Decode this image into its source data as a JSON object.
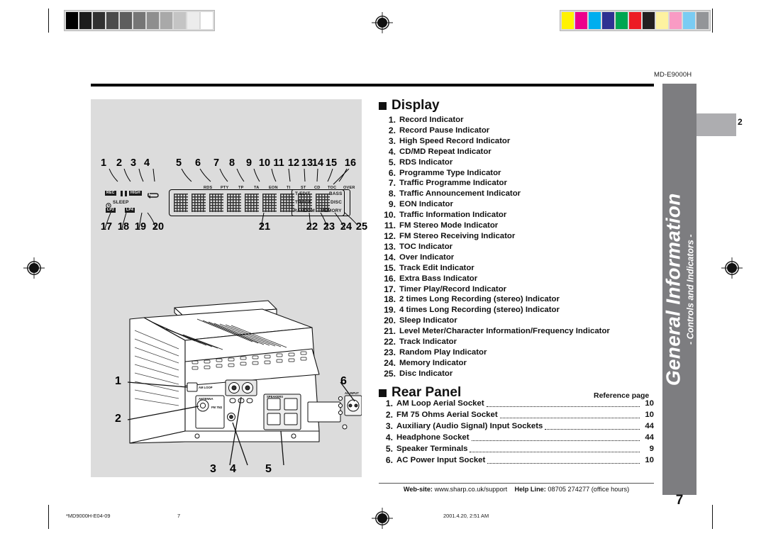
{
  "document": {
    "model_code": "MD-E9000H",
    "tab_number": "2",
    "page_number": "7",
    "sidebar_title": "General Information",
    "sidebar_subtitle": "- Controls and Indicators -"
  },
  "display_section": {
    "heading": "Display",
    "items": [
      {
        "n": "1.",
        "label": "Record Indicator"
      },
      {
        "n": "2.",
        "label": "Record Pause Indicator"
      },
      {
        "n": "3.",
        "label": "High Speed Record Indicator"
      },
      {
        "n": "4.",
        "label": "CD/MD Repeat Indicator"
      },
      {
        "n": "5.",
        "label": "RDS Indicator"
      },
      {
        "n": "6.",
        "label": "Programme Type Indicator"
      },
      {
        "n": "7.",
        "label": "Traffic Programme Indicator"
      },
      {
        "n": "8.",
        "label": "Traffic Announcement Indicator"
      },
      {
        "n": "9.",
        "label": "EON Indicator"
      },
      {
        "n": "10.",
        "label": "Traffic Information Indicator"
      },
      {
        "n": "11.",
        "label": "FM Stereo Mode Indicator"
      },
      {
        "n": "12.",
        "label": "FM Stereo Receiving Indicator"
      },
      {
        "n": "13.",
        "label": "TOC Indicator"
      },
      {
        "n": "14.",
        "label": "Over Indicator"
      },
      {
        "n": "15.",
        "label": "Track Edit Indicator"
      },
      {
        "n": "16.",
        "label": "Extra Bass Indicator"
      },
      {
        "n": "17.",
        "label": "Timer Play/Record Indicator"
      },
      {
        "n": "18.",
        "label": "2 times Long Recording (stereo) Indicator"
      },
      {
        "n": "19.",
        "label": "4 times Long Recording (stereo) Indicator"
      },
      {
        "n": "20.",
        "label": "Sleep Indicator"
      },
      {
        "n": "21.",
        "label": "Level Meter/Character Information/Frequency Indicator"
      },
      {
        "n": "22.",
        "label": "Track Indicator"
      },
      {
        "n": "23.",
        "label": "Random Play Indicator"
      },
      {
        "n": "24.",
        "label": "Memory Indicator"
      },
      {
        "n": "25.",
        "label": "Disc Indicator"
      }
    ]
  },
  "rear_panel_section": {
    "heading": "Rear Panel",
    "reference_page_label": "Reference page",
    "items": [
      {
        "n": "1.",
        "label": "AM Loop Aerial Socket",
        "page": "10"
      },
      {
        "n": "2.",
        "label": "FM 75 Ohms Aerial Socket",
        "page": "10"
      },
      {
        "n": "3.",
        "label": "Auxiliary (Audio Signal) Input Sockets",
        "page": "44"
      },
      {
        "n": "4.",
        "label": "Headphone Socket",
        "page": "44"
      },
      {
        "n": "5.",
        "label": "Speaker Terminals",
        "page": "9"
      },
      {
        "n": "6.",
        "label": "AC Power Input Socket",
        "page": "10"
      }
    ]
  },
  "lcd_diagram": {
    "top_callouts": [
      "1",
      "2",
      "3",
      "4",
      "5",
      "6",
      "7",
      "8",
      "9",
      "10",
      "11",
      "12",
      "13",
      "14",
      "15",
      "16"
    ],
    "bottom_callouts": [
      "17",
      "18",
      "19",
      "20",
      "21",
      "22",
      "23",
      "24",
      "25"
    ],
    "indicator_labels": [
      "REC",
      "HIGH",
      "SLEEP",
      "LP2",
      "LP4",
      "RDS",
      "PTY",
      "TP",
      "TA",
      "EON",
      "TI",
      "ST",
      "CD",
      "TOC",
      "OVER",
      "T-EDIT",
      "BASS",
      "TRACK",
      "DISC",
      "RANDOM",
      "MEMORY"
    ]
  },
  "rear_diagram": {
    "callouts": [
      "1",
      "2",
      "3",
      "4",
      "5",
      "6"
    ],
    "port_labels": [
      "AM LOOP",
      "ANTENNA",
      "FM 75Ω",
      "SPEAKERS",
      "AC INPUT"
    ]
  },
  "footer": {
    "website_label": "Web-site:",
    "website_url": "www.sharp.co.uk/support",
    "helpline_label": "Help Line:",
    "helpline_value": "08705 274277 (office hours)",
    "file_code": "*MD9000H-E04-09",
    "sheet_number": "7",
    "timestamp": "2001.4.20, 2:51 AM"
  },
  "print_marks": {
    "step_wedge": [
      "#000000",
      "#1c1c1c",
      "#313131",
      "#4b4b4b",
      "#5e5e5e",
      "#767676",
      "#8e8e8e",
      "#a9a9a9",
      "#c4c4c4",
      "#ececec",
      "#ffffff"
    ],
    "color_bars": [
      "#fff200",
      "#ec008c",
      "#00aeef",
      "#2e3192",
      "#00a651",
      "#ed1c24",
      "#231f20",
      "#fdf2a0",
      "#f99bc4",
      "#7accf3",
      "#939598"
    ]
  }
}
